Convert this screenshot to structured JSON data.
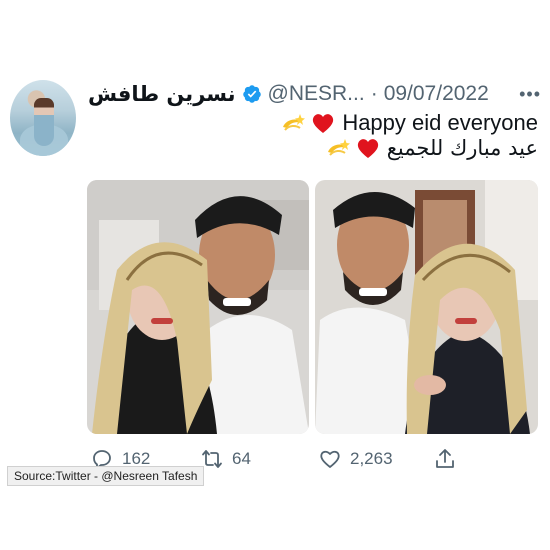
{
  "tweet": {
    "author": {
      "display_name": "نسرين طافش",
      "handle": "@NESR...",
      "verified": true,
      "avatar_icon": "profile-photo"
    },
    "separator": "·",
    "date": "09/07/2022",
    "more_icon": "more-dots-icon",
    "text_line_1": "Happy eid everyone",
    "text_line_2": "عيد مبارك للجميع",
    "emojis": [
      "dizzy-emoji",
      "red-heart-emoji"
    ],
    "media": [
      {
        "name": "photo-1",
        "description_icon": "couple-selfie-photo"
      },
      {
        "name": "photo-2",
        "description_icon": "couple-selfie-photo"
      }
    ],
    "actions": {
      "replies": "162",
      "retweets": "64",
      "likes": "2,263"
    }
  },
  "colors": {
    "verified_blue": "#1d9bf0",
    "muted_gray": "#536471",
    "heart_red": "#e0141e"
  },
  "source_caption": "Source:Twitter - @Nesreen Tafesh"
}
